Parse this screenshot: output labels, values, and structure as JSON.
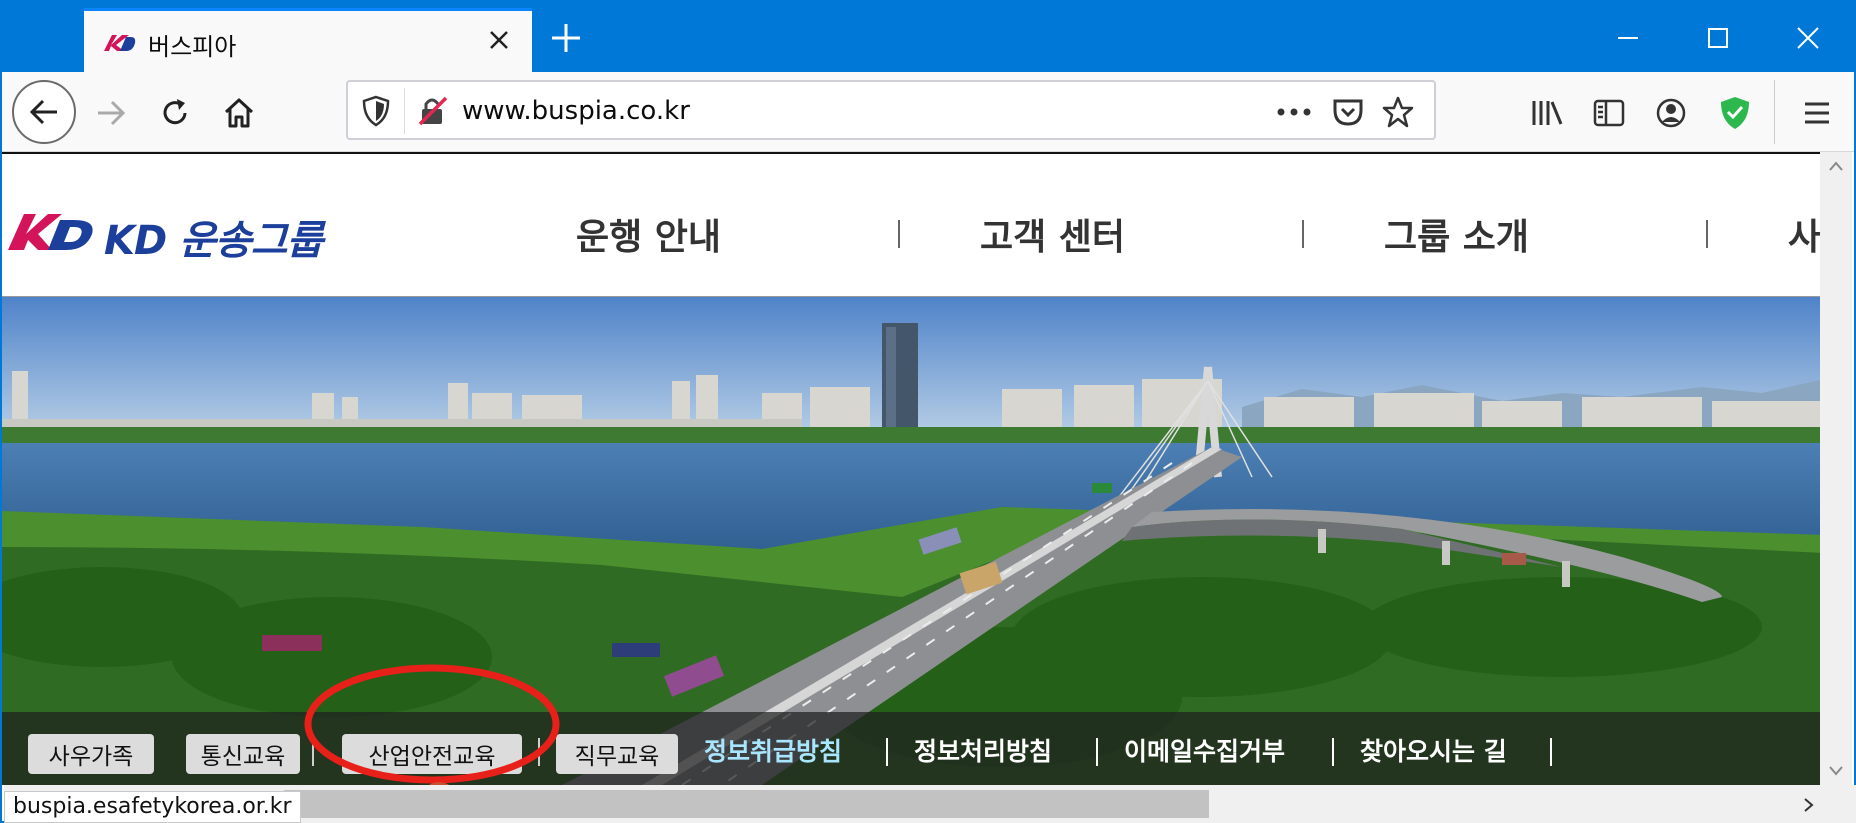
{
  "browser": {
    "tab_title": "버스피아",
    "url": "www.buspia.co.kr",
    "status_url": "buspia.esafetykorea.or.kr",
    "accent": "#0078d7"
  },
  "site": {
    "logo_text": "KD 운송그룹",
    "menu": [
      "운행 안내",
      "고객 센터",
      "그룹 소개",
      "사"
    ],
    "footer_pills": [
      "사우가족",
      "통신교육",
      "산업안전교육",
      "직무교육"
    ],
    "footer_links": [
      "정보취급방침",
      "정보처리방침",
      "이메일수집거부",
      "찾아오시는 길"
    ],
    "highlight_link_color": "#a8e6ff"
  },
  "annotation": {
    "number": "1",
    "color": "#e8201a"
  }
}
